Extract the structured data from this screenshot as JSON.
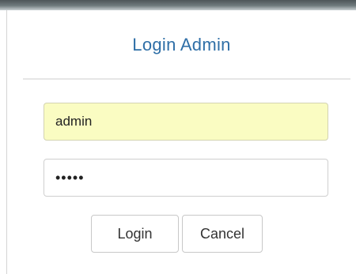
{
  "dialog": {
    "title": "Login Admin"
  },
  "form": {
    "username_value": "admin",
    "password_value": "•••••",
    "login_label": "Login",
    "cancel_label": "Cancel"
  },
  "colors": {
    "title": "#2f6fa7",
    "autofill_background": "#fafcc2"
  }
}
